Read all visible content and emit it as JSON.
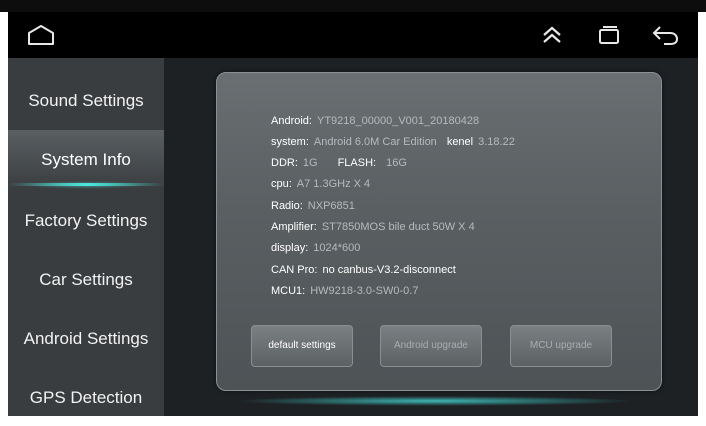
{
  "sidebar": {
    "items": [
      {
        "label": "Sound Settings"
      },
      {
        "label": "System Info"
      },
      {
        "label": "Factory Settings"
      },
      {
        "label": "Car Settings"
      },
      {
        "label": "Android Settings"
      },
      {
        "label": "GPS Detection"
      }
    ],
    "active_index": 1
  },
  "statusbar": {
    "icons": [
      "home-icon",
      "double-chevron-up-icon",
      "recent-apps-icon",
      "back-icon"
    ]
  },
  "info": {
    "android": {
      "label": "Android:",
      "value": "YT9218_00000_V001_20180428"
    },
    "system": {
      "label": "system:",
      "value": "Android 6.0M Car Edition"
    },
    "kenel": {
      "label": "kenel",
      "value": "3.18.22"
    },
    "ddr": {
      "label": "DDR:",
      "value": "1G"
    },
    "flash": {
      "label": "FLASH:",
      "value": "16G"
    },
    "cpu": {
      "label": "cpu:",
      "value": "A7 1.3GHz X 4"
    },
    "radio": {
      "label": "Radio:",
      "value": "NXP6851"
    },
    "amplifier": {
      "label": "Amplifier:",
      "value": "ST7850MOS bile duct 50W X 4"
    },
    "display": {
      "label": "display:",
      "value": "1024*600"
    },
    "can_pro": {
      "label": "CAN Pro:",
      "value": "no canbus-V3.2-disconnect"
    },
    "mcu1": {
      "label": "MCU1:",
      "value": "HW9218-3.0-SW0-0.7"
    }
  },
  "buttons": {
    "default_settings": "default settings",
    "android_upgrade": "Android upgrade",
    "mcu_upgrade": "MCU upgrade"
  },
  "colors": {
    "accent": "#4ee6dd",
    "panel": "#5b6063",
    "sidebar": "#3a3d3f",
    "label": "#ffffff",
    "value": "#b5babd"
  }
}
